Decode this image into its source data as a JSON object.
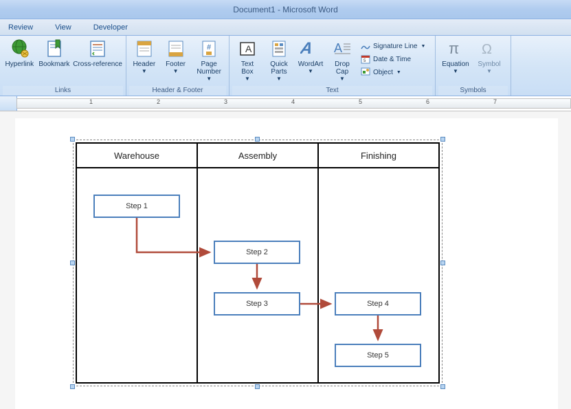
{
  "window": {
    "title": "Document1 - Microsoft Word"
  },
  "tabs": {
    "review": "Review",
    "view": "View",
    "developer": "Developer"
  },
  "ribbon": {
    "links": {
      "label": "Links",
      "hyperlink": "Hyperlink",
      "bookmark": "Bookmark",
      "crossref": "Cross-reference"
    },
    "hf": {
      "label": "Header & Footer",
      "header": "Header",
      "footer": "Footer",
      "pagenum": "Page\nNumber"
    },
    "text": {
      "label": "Text",
      "textbox": "Text\nBox",
      "quickparts": "Quick\nParts",
      "wordart": "WordArt",
      "dropcap": "Drop\nCap",
      "sigline": "Signature Line",
      "datetime": "Date & Time",
      "object": "Object"
    },
    "symbols": {
      "label": "Symbols",
      "equation": "Equation",
      "symbol": "Symbol"
    }
  },
  "ruler": [
    "1",
    "2",
    "3",
    "4",
    "5",
    "6",
    "7"
  ],
  "diagram": {
    "lanes": [
      "Warehouse",
      "Assembly",
      "Finishing"
    ],
    "steps": {
      "s1": "Step 1",
      "s2": "Step 2",
      "s3": "Step 3",
      "s4": "Step 4",
      "s5": "Step 5"
    }
  }
}
